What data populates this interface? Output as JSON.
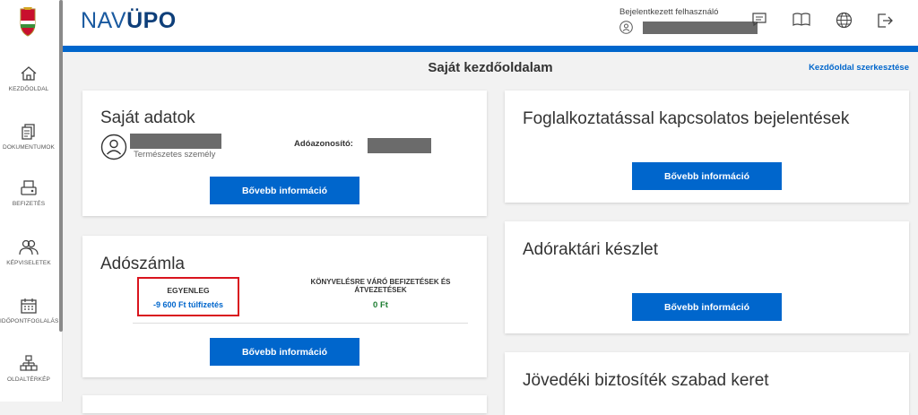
{
  "brand": {
    "nav": "NAV",
    "upo": "ÜPO"
  },
  "sidebar": {
    "items": [
      {
        "label": "KEZDŐOLDAL",
        "icon": "home-icon"
      },
      {
        "label": "DOKUMENTUMOK",
        "icon": "documents-icon"
      },
      {
        "label": "BEFIZETÉS",
        "icon": "payment-icon"
      },
      {
        "label": "KÉPVISELETEK",
        "icon": "people-icon"
      },
      {
        "label": "IDŐPONTFOGLALÁS",
        "icon": "calendar-icon"
      },
      {
        "label": "OLDALTÉRKÉP",
        "icon": "sitemap-icon"
      }
    ]
  },
  "header": {
    "user_label": "Bejelentkezett felhasználó",
    "icons": [
      "message-icon",
      "book-icon",
      "globe-icon",
      "logout-icon"
    ]
  },
  "page": {
    "title": "Saját kezdőoldalam",
    "edit_link": "Kezdőoldal szerkesztése"
  },
  "cards": {
    "own_data": {
      "title": "Saját adatok",
      "person_type": "Természetes személy",
      "tax_id_label": "Adóazonosító:",
      "button": "Bővebb információ"
    },
    "tax_account": {
      "title": "Adószámla",
      "balance_label": "EGYENLEG",
      "balance_value": "-9 600 Ft túlfizetés",
      "pending_label": "KÖNYVELÉSRE VÁRÓ BEFIZETÉSEK ÉS ÁTVEZETÉSEK",
      "pending_value": "0 Ft",
      "button": "Bővebb információ"
    },
    "employment": {
      "title": "Foglalkoztatással kapcsolatos bejelentések",
      "button": "Bővebb információ"
    },
    "warehouse": {
      "title": "Adóraktári készlet",
      "button": "Bővebb információ"
    },
    "excise": {
      "title": "Jövedéki biztosíték szabad keret"
    }
  },
  "colors": {
    "accent": "#0066cc",
    "highlight_border": "#d9141e",
    "positive": "#1e7d32"
  }
}
